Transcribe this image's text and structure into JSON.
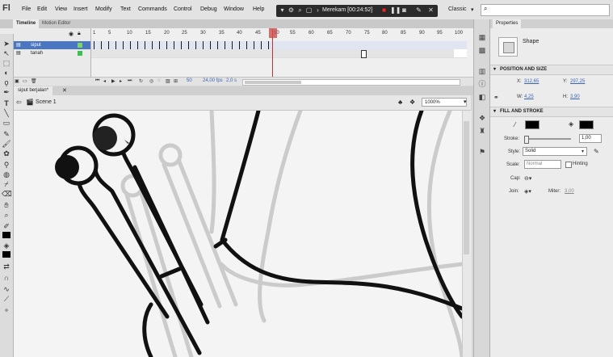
{
  "app": {
    "logo": "Fl"
  },
  "menu": [
    "File",
    "Edit",
    "View",
    "Insert",
    "Modify",
    "Text",
    "Commands",
    "Control",
    "Debug",
    "Window",
    "Help"
  ],
  "recorder": {
    "label": "Merekam [00:24:52]"
  },
  "workspace": {
    "label": "Classic"
  },
  "search": {
    "placeholder": ""
  },
  "timeline": {
    "tabs": [
      "Timeline",
      "Motion Editor"
    ],
    "layers": [
      {
        "name": "siput"
      },
      {
        "name": "tanah"
      }
    ],
    "ruler": [
      "1",
      "5",
      "10",
      "15",
      "20",
      "25",
      "30",
      "35",
      "40",
      "45",
      "50",
      "55",
      "60",
      "65",
      "70",
      "75",
      "80",
      "85",
      "90",
      "95",
      "100"
    ],
    "footer": {
      "frame": "50",
      "fps": "24,00 fps",
      "time": "2,0 s"
    }
  },
  "document": {
    "tab": "siput berjalan*",
    "scene": "Scene 1",
    "zoom": "1000%"
  },
  "properties": {
    "tab": "Properties",
    "object": "Shape",
    "position_size": {
      "title": "POSITION AND SIZE",
      "x_label": "X:",
      "x": "312,65",
      "y_label": "Y:",
      "y": "297,25",
      "w_label": "W:",
      "w": "4,25",
      "h_label": "H:",
      "h": "3,90"
    },
    "fill_stroke": {
      "title": "FILL AND STROKE",
      "stroke_color": "#000000",
      "fill_color": "#000000",
      "stroke_label": "Stroke:",
      "stroke": "1,00",
      "style_label": "Style:",
      "style": "Solid",
      "scale_label": "Scale:",
      "scale": "Normal",
      "hinting_label": "Hinting",
      "cap_label": "Cap:",
      "join_label": "Join:",
      "miter_label": "Miter:",
      "miter": "3,00"
    }
  },
  "colors": {
    "accent": "#4a76c2",
    "playhead": "#d12b2b",
    "stage": "#f4f4f4"
  }
}
